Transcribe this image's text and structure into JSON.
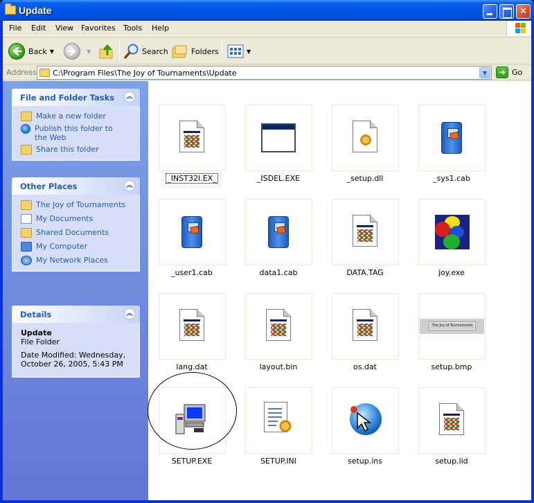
{
  "window": {
    "title": "Update"
  },
  "menu": [
    "File",
    "Edit",
    "View",
    "Favorites",
    "Tools",
    "Help"
  ],
  "toolbar": {
    "back": "Back",
    "search": "Search",
    "folders": "Folders"
  },
  "address": {
    "label": "Address",
    "path": "C:\\Program Files\\The Joy of Tournaments\\Update",
    "go": "Go"
  },
  "taskpane": {
    "file_tasks": {
      "title": "File and Folder Tasks",
      "items": [
        "Make a new folder",
        "Publish this folder to the Web",
        "Share this folder"
      ]
    },
    "other_places": {
      "title": "Other Places",
      "items": [
        "The Joy of Tournaments",
        "My Documents",
        "Shared Documents",
        "My Computer",
        "My Network Places"
      ]
    },
    "details": {
      "title": "Details",
      "name": "Update",
      "type": "File Folder",
      "modified": "Date Modified: Wednesday, October 26, 2005, 5:43 PM"
    }
  },
  "files": [
    {
      "name": "_INST32I.EX_",
      "icon": "app-icon"
    },
    {
      "name": "_ISDEL.EXE",
      "icon": "window-icon"
    },
    {
      "name": "_setup.dll",
      "icon": "dll-icon"
    },
    {
      "name": "_sys1.cab",
      "icon": "cab-icon"
    },
    {
      "name": "_user1.cab",
      "icon": "cab-icon"
    },
    {
      "name": "data1.cab",
      "icon": "cab-icon"
    },
    {
      "name": "DATA.TAG",
      "icon": "app-icon"
    },
    {
      "name": "joy.exe",
      "icon": "joy-icon"
    },
    {
      "name": "lang.dat",
      "icon": "app-icon"
    },
    {
      "name": "layout.bin",
      "icon": "app-icon"
    },
    {
      "name": "os.dat",
      "icon": "app-icon"
    },
    {
      "name": "setup.bmp",
      "icon": "bmp-thumbnail"
    },
    {
      "name": "SETUP.EXE",
      "icon": "setup-exe-icon"
    },
    {
      "name": "SETUP.INI",
      "icon": "ini-icon"
    },
    {
      "name": "setup.ins",
      "icon": "ins-icon"
    },
    {
      "name": "setup.lid",
      "icon": "app-icon"
    }
  ],
  "bmp_thumb_text": "The Joy of Tournaments",
  "colors": {
    "titlebar": "#0053e6",
    "task_link": "#215dc6",
    "taskpane_bg": "#7ba2e7"
  }
}
